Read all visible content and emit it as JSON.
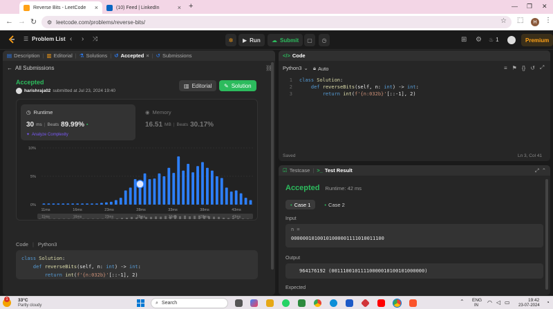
{
  "browser": {
    "tabs": [
      {
        "label": "Reverse Bits - LeetCode",
        "active": true
      },
      {
        "label": "(10) Feed | LinkedIn",
        "active": false
      }
    ],
    "new_tab": "+",
    "url": "leetcode.com/problems/reverse-bits/",
    "profile_initial": "H"
  },
  "lc_nav": {
    "problem_list": "Problem List",
    "run": "Run",
    "submit": "Submit",
    "streak": "1",
    "premium": "Premium"
  },
  "left_panel": {
    "tabs": [
      "Description",
      "Editorial",
      "Solutions",
      "Accepted",
      "Submissions"
    ],
    "back": "All Submissions",
    "status": "Accepted",
    "user": "harishraja02",
    "submitted": "submitted at Jul 23, 2024 19:40",
    "editorial_btn": "Editorial",
    "solution_btn": "Solution",
    "runtime_label": "Runtime",
    "runtime_value": "30",
    "runtime_unit": "ms",
    "beats_label": "Beats",
    "runtime_beats": "89.99%",
    "analyze": "Analyze Complexity",
    "memory_label": "Memory",
    "memory_value": "16.51",
    "memory_unit": "MB",
    "memory_beats": "30.17%",
    "code_label": "Code",
    "code_lang": "Python3",
    "code_lines": [
      "class Solution:",
      "    def reverseBits(self, n: int) -> int:",
      "        return int(f'{n:032b}'[::-1], 2)"
    ]
  },
  "chart_data": {
    "type": "bar",
    "ylabels": [
      "10%",
      "5%",
      "0%"
    ],
    "ylim": [
      0,
      10
    ],
    "xticks": [
      "11ms",
      "16ms",
      "23ms",
      "28ms",
      "33ms",
      "38ms",
      "43ms"
    ],
    "values": [
      0.2,
      0.2,
      0.2,
      0.2,
      0.2,
      0.2,
      0.2,
      0.2,
      0.2,
      0.2,
      0.2,
      0.2,
      0.3,
      0.4,
      0.5,
      0.8,
      1.2,
      2.5,
      3.0,
      4.5,
      3.5,
      5.5,
      4.5,
      4.6,
      5.5,
      5.0,
      6.5,
      5.6,
      8.5,
      6.0,
      7.2,
      5.7,
      6.8,
      7.5,
      6.5,
      6.0,
      5.0,
      4.7,
      3.0,
      2.3,
      2.5,
      2.0,
      1.2,
      0.8
    ],
    "highlight_index": 20,
    "bar_color": "#2d7ff9",
    "highlight_color": "#ffffff"
  },
  "editor": {
    "title": "Code",
    "lang": "Python3",
    "mode": "Auto",
    "lines": [
      "class Solution:",
      "    def reverseBits(self, n: int) -> int:",
      "        return int(f'{n:032b}'[::-1], 2)"
    ],
    "saved": "Saved",
    "cursor": "Ln 3, Col 41"
  },
  "result_panel": {
    "testcase_tab": "Testcase",
    "result_tab": "Test Result",
    "status": "Accepted",
    "runtime": "Runtime: 42 ms",
    "case1": "Case 1",
    "case2": "Case 2",
    "input_label": "Input",
    "input_var": "n =",
    "input_value": "00000010100101000001111010011100",
    "output_label": "Output",
    "output_value": "964176192 (00111001011110000010100101000000)",
    "expected_label": "Expected"
  },
  "taskbar": {
    "temp": "33°C",
    "weather": "Partly cloudy",
    "search": "Search",
    "lang": "ENG",
    "region": "IN",
    "time": "19:42",
    "date": "23-07-2024",
    "badge": "1"
  },
  "colors": {
    "accent": "#ffa116",
    "green": "#2cbb5d",
    "blue": "#2d7ff9"
  }
}
